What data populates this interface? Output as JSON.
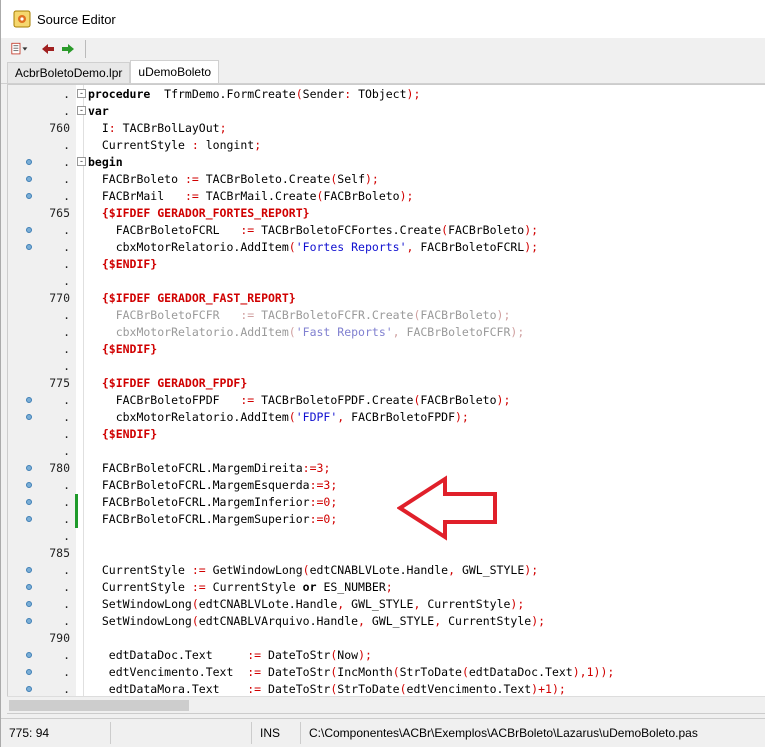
{
  "window": {
    "title": "Source Editor"
  },
  "tabs": [
    {
      "label": "AcbrBoletoDemo.lpr",
      "active": false
    },
    {
      "label": "uDemoBoleto",
      "active": true
    }
  ],
  "status": {
    "position": "775: 94",
    "mode": "INS",
    "path": "C:\\Componentes\\ACBr\\Exemplos\\ACBrBoleto\\Lazarus\\uDemoBoleto.pas"
  },
  "colors": {
    "breakpoint": "#7aaed6",
    "modified_bar": "#1e9a2a",
    "annotation_arrow": "#e0202a"
  },
  "lines": [
    {
      "num": ".",
      "bp": false,
      "fold": "-",
      "segs": [
        [
          "kw",
          "procedure"
        ],
        [
          "",
          "  TfrmDemo.FormCreate"
        ],
        [
          "sym",
          "("
        ],
        [
          "",
          "Sender"
        ],
        [
          "sym",
          ":"
        ],
        [
          "",
          " TObject"
        ],
        [
          "sym",
          ");"
        ]
      ]
    },
    {
      "num": ".",
      "bp": false,
      "fold": "-",
      "segs": [
        [
          "kw",
          "var"
        ]
      ]
    },
    {
      "num": "760",
      "bp": false,
      "segs": [
        [
          "",
          "  I"
        ],
        [
          "sym",
          ":"
        ],
        [
          "",
          " TACBrBolLayOut"
        ],
        [
          "sym",
          ";"
        ]
      ]
    },
    {
      "num": ".",
      "bp": false,
      "segs": [
        [
          "",
          "  CurrentStyle "
        ],
        [
          "sym",
          ":"
        ],
        [
          "",
          " longint"
        ],
        [
          "sym",
          ";"
        ]
      ]
    },
    {
      "num": ".",
      "bp": true,
      "fold": "-",
      "segs": [
        [
          "kw",
          "begin"
        ]
      ]
    },
    {
      "num": ".",
      "bp": true,
      "segs": [
        [
          "",
          "  FACBrBoleto "
        ],
        [
          "sym",
          ":="
        ],
        [
          "",
          " TACBrBoleto.Create"
        ],
        [
          "sym",
          "("
        ],
        [
          "",
          "Self"
        ],
        [
          "sym",
          ");"
        ]
      ]
    },
    {
      "num": ".",
      "bp": true,
      "segs": [
        [
          "",
          "  FACBrMail   "
        ],
        [
          "sym",
          ":="
        ],
        [
          "",
          " TACBrMail.Create"
        ],
        [
          "sym",
          "("
        ],
        [
          "",
          "FACBrBoleto"
        ],
        [
          "sym",
          ");"
        ]
      ]
    },
    {
      "num": "765",
      "bp": false,
      "segs": [
        [
          "dir",
          "  {$IFDEF GERADOR_FORTES_REPORT}"
        ]
      ]
    },
    {
      "num": ".",
      "bp": true,
      "segs": [
        [
          "",
          "    FACBrBoletoFCRL   "
        ],
        [
          "sym",
          ":="
        ],
        [
          "",
          " TACBrBoletoFCFortes.Create"
        ],
        [
          "sym",
          "("
        ],
        [
          "",
          "FACBrBoleto"
        ],
        [
          "sym",
          ");"
        ]
      ]
    },
    {
      "num": ".",
      "bp": true,
      "segs": [
        [
          "",
          "    cbxMotorRelatorio.AddItem"
        ],
        [
          "sym",
          "("
        ],
        [
          "str",
          "'Fortes Reports'"
        ],
        [
          "sym",
          ","
        ],
        [
          "",
          " FACBrBoletoFCRL"
        ],
        [
          "sym",
          ");"
        ]
      ]
    },
    {
      "num": ".",
      "bp": false,
      "segs": [
        [
          "dir",
          "  {$ENDIF}"
        ]
      ]
    },
    {
      "num": ".",
      "bp": false,
      "segs": []
    },
    {
      "num": "770",
      "bp": false,
      "segs": [
        [
          "dir",
          "  {$IFDEF GERADOR_FAST_REPORT}"
        ]
      ]
    },
    {
      "num": ".",
      "bp": false,
      "inactive": true,
      "segs": [
        [
          "",
          "    FACBrBoletoFCFR   "
        ],
        [
          "sym",
          ":="
        ],
        [
          "",
          " TACBrBoletoFCFR.Create"
        ],
        [
          "sym",
          "("
        ],
        [
          "",
          "FACBrBoleto"
        ],
        [
          "sym",
          ");"
        ]
      ]
    },
    {
      "num": ".",
      "bp": false,
      "inactive": true,
      "segs": [
        [
          "",
          "    cbxMotorRelatorio.AddItem"
        ],
        [
          "sym",
          "("
        ],
        [
          "str",
          "'Fast Reports'"
        ],
        [
          "sym",
          ","
        ],
        [
          "",
          " FACBrBoletoFCFR"
        ],
        [
          "sym",
          ");"
        ]
      ]
    },
    {
      "num": ".",
      "bp": false,
      "segs": [
        [
          "dir",
          "  {$ENDIF}"
        ]
      ]
    },
    {
      "num": ".",
      "bp": false,
      "segs": []
    },
    {
      "num": "775",
      "bp": false,
      "segs": [
        [
          "dir",
          "  {$IFDEF GERADOR_FPDF}"
        ]
      ]
    },
    {
      "num": ".",
      "bp": true,
      "segs": [
        [
          "",
          "    FACBrBoletoFPDF   "
        ],
        [
          "sym",
          ":="
        ],
        [
          "",
          " TACBrBoletoFPDF.Create"
        ],
        [
          "sym",
          "("
        ],
        [
          "",
          "FACBrBoleto"
        ],
        [
          "sym",
          ");"
        ]
      ]
    },
    {
      "num": ".",
      "bp": true,
      "segs": [
        [
          "",
          "    cbxMotorRelatorio.AddItem"
        ],
        [
          "sym",
          "("
        ],
        [
          "str",
          "'FDPF'"
        ],
        [
          "sym",
          ","
        ],
        [
          "",
          " FACBrBoletoFPDF"
        ],
        [
          "sym",
          ");"
        ]
      ]
    },
    {
      "num": ".",
      "bp": false,
      "segs": [
        [
          "dir",
          "  {$ENDIF}"
        ]
      ]
    },
    {
      "num": ".",
      "bp": false,
      "segs": []
    },
    {
      "num": "780",
      "bp": true,
      "segs": [
        [
          "",
          "  FACBrBoletoFCRL.MargemDireita"
        ],
        [
          "sym",
          ":="
        ],
        [
          "num",
          "3"
        ],
        [
          "sym",
          ";"
        ]
      ]
    },
    {
      "num": ".",
      "bp": true,
      "segs": [
        [
          "",
          "  FACBrBoletoFCRL.MargemEsquerda"
        ],
        [
          "sym",
          ":="
        ],
        [
          "num",
          "3"
        ],
        [
          "sym",
          ";"
        ]
      ]
    },
    {
      "num": ".",
      "bp": true,
      "mod": true,
      "segs": [
        [
          "",
          "  FACBrBoletoFCRL.MargemInferior"
        ],
        [
          "sym",
          ":="
        ],
        [
          "num",
          "0"
        ],
        [
          "sym",
          ";"
        ]
      ]
    },
    {
      "num": ".",
      "bp": true,
      "mod": true,
      "segs": [
        [
          "",
          "  FACBrBoletoFCRL.MargemSuperior"
        ],
        [
          "sym",
          ":="
        ],
        [
          "num",
          "0"
        ],
        [
          "sym",
          ";"
        ]
      ]
    },
    {
      "num": ".",
      "bp": false,
      "segs": []
    },
    {
      "num": "785",
      "bp": false,
      "segs": []
    },
    {
      "num": ".",
      "bp": true,
      "segs": [
        [
          "",
          "  CurrentStyle "
        ],
        [
          "sym",
          ":="
        ],
        [
          "",
          " GetWindowLong"
        ],
        [
          "sym",
          "("
        ],
        [
          "",
          "edtCNABLVLote.Handle"
        ],
        [
          "sym",
          ","
        ],
        [
          "",
          " GWL_STYLE"
        ],
        [
          "sym",
          ");"
        ]
      ]
    },
    {
      "num": ".",
      "bp": true,
      "segs": [
        [
          "",
          "  CurrentStyle "
        ],
        [
          "sym",
          ":="
        ],
        [
          "",
          " CurrentStyle "
        ],
        [
          "kw",
          "or"
        ],
        [
          "",
          " ES_NUMBER"
        ],
        [
          "sym",
          ";"
        ]
      ]
    },
    {
      "num": ".",
      "bp": true,
      "segs": [
        [
          "",
          "  SetWindowLong"
        ],
        [
          "sym",
          "("
        ],
        [
          "",
          "edtCNABLVLote.Handle"
        ],
        [
          "sym",
          ","
        ],
        [
          "",
          " GWL_STYLE"
        ],
        [
          "sym",
          ","
        ],
        [
          "",
          " CurrentStyle"
        ],
        [
          "sym",
          ");"
        ]
      ]
    },
    {
      "num": ".",
      "bp": true,
      "segs": [
        [
          "",
          "  SetWindowLong"
        ],
        [
          "sym",
          "("
        ],
        [
          "",
          "edtCNABLVArquivo.Handle"
        ],
        [
          "sym",
          ","
        ],
        [
          "",
          " GWL_STYLE"
        ],
        [
          "sym",
          ","
        ],
        [
          "",
          " CurrentStyle"
        ],
        [
          "sym",
          ");"
        ]
      ]
    },
    {
      "num": "790",
      "bp": false,
      "segs": []
    },
    {
      "num": ".",
      "bp": true,
      "segs": [
        [
          "",
          "   edtDataDoc.Text     "
        ],
        [
          "sym",
          ":="
        ],
        [
          "",
          " DateToStr"
        ],
        [
          "sym",
          "("
        ],
        [
          "",
          "Now"
        ],
        [
          "sym",
          ");"
        ]
      ]
    },
    {
      "num": ".",
      "bp": true,
      "segs": [
        [
          "",
          "   edtVencimento.Text  "
        ],
        [
          "sym",
          ":="
        ],
        [
          "",
          " DateToStr"
        ],
        [
          "sym",
          "("
        ],
        [
          "",
          "IncMonth"
        ],
        [
          "sym",
          "("
        ],
        [
          "",
          "StrToDate"
        ],
        [
          "sym",
          "("
        ],
        [
          "",
          "edtDataDoc.Text"
        ],
        [
          "sym",
          "),"
        ],
        [
          "num",
          "1"
        ],
        [
          "sym",
          "));"
        ]
      ]
    },
    {
      "num": ".",
      "bp": true,
      "segs": [
        [
          "",
          "   edtDataMora.Text    "
        ],
        [
          "sym",
          ":="
        ],
        [
          "",
          " DateToStr"
        ],
        [
          "sym",
          "("
        ],
        [
          "",
          "StrToDate"
        ],
        [
          "sym",
          "("
        ],
        [
          "",
          "edtVencimento.Text"
        ],
        [
          "sym",
          ")+"
        ],
        [
          "num",
          "1"
        ],
        [
          "sym",
          ");"
        ]
      ]
    }
  ]
}
